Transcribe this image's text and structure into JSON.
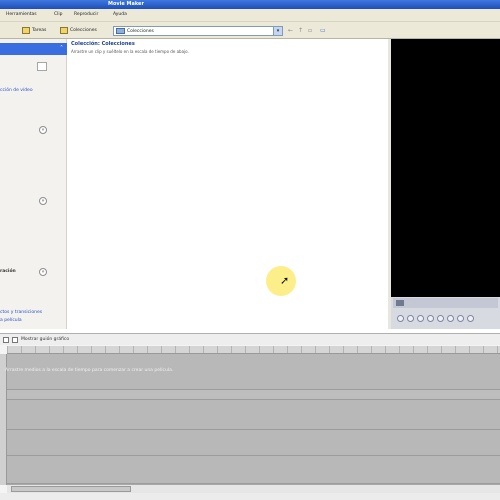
{
  "window": {
    "title": "Movie Maker"
  },
  "menu": {
    "items": [
      "Herramientas",
      "Clip",
      "Reproducir",
      "Ayuda"
    ]
  },
  "toolbar": {
    "tasks_label": "Tareas",
    "collections_label": "Colecciones",
    "collection_selector": "Colecciones"
  },
  "task_pane": {
    "links": [
      "cción de vídeo",
      "ctos y transiciones",
      "a película"
    ],
    "section_labels": [
      "ración"
    ]
  },
  "collections": {
    "breadcrumb": "Colección: Colecciones",
    "description": "Arrastre un clip y suéltelo en la escala de tiempo de abajo."
  },
  "storyboard": {
    "toggle_label": "Mostrar guión gráfico",
    "hint": "Arrastre medios a la escala de tiempo para comenzar a crear una película."
  }
}
